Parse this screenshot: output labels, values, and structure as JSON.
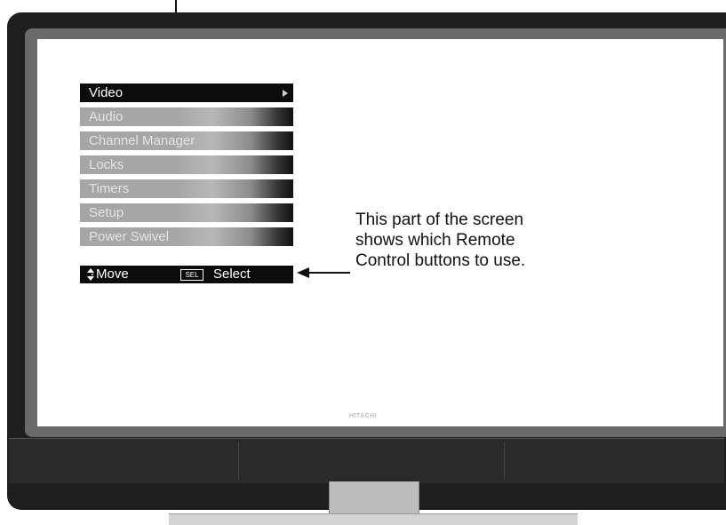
{
  "tv": {
    "brand_logo": "HITACHI"
  },
  "menu": {
    "items": [
      {
        "label": "Video",
        "active": true
      },
      {
        "label": "Audio",
        "active": false
      },
      {
        "label": "Channel Manager",
        "active": false
      },
      {
        "label": "Locks",
        "active": false
      },
      {
        "label": "Timers",
        "active": false
      },
      {
        "label": "Setup",
        "active": false
      },
      {
        "label": "Power Swivel",
        "active": false
      }
    ],
    "help": {
      "move_label": "Move",
      "sel_icon_text": "SEL",
      "select_label": "Select"
    }
  },
  "callout": {
    "lines": [
      "This part of the screen",
      "shows which Remote",
      "Control buttons to use."
    ]
  },
  "colors": {
    "menu_active_bg": "#0c0c0c",
    "menu_item_gray": "#a6a6a6",
    "tv_frame": "#1e1e1e"
  }
}
